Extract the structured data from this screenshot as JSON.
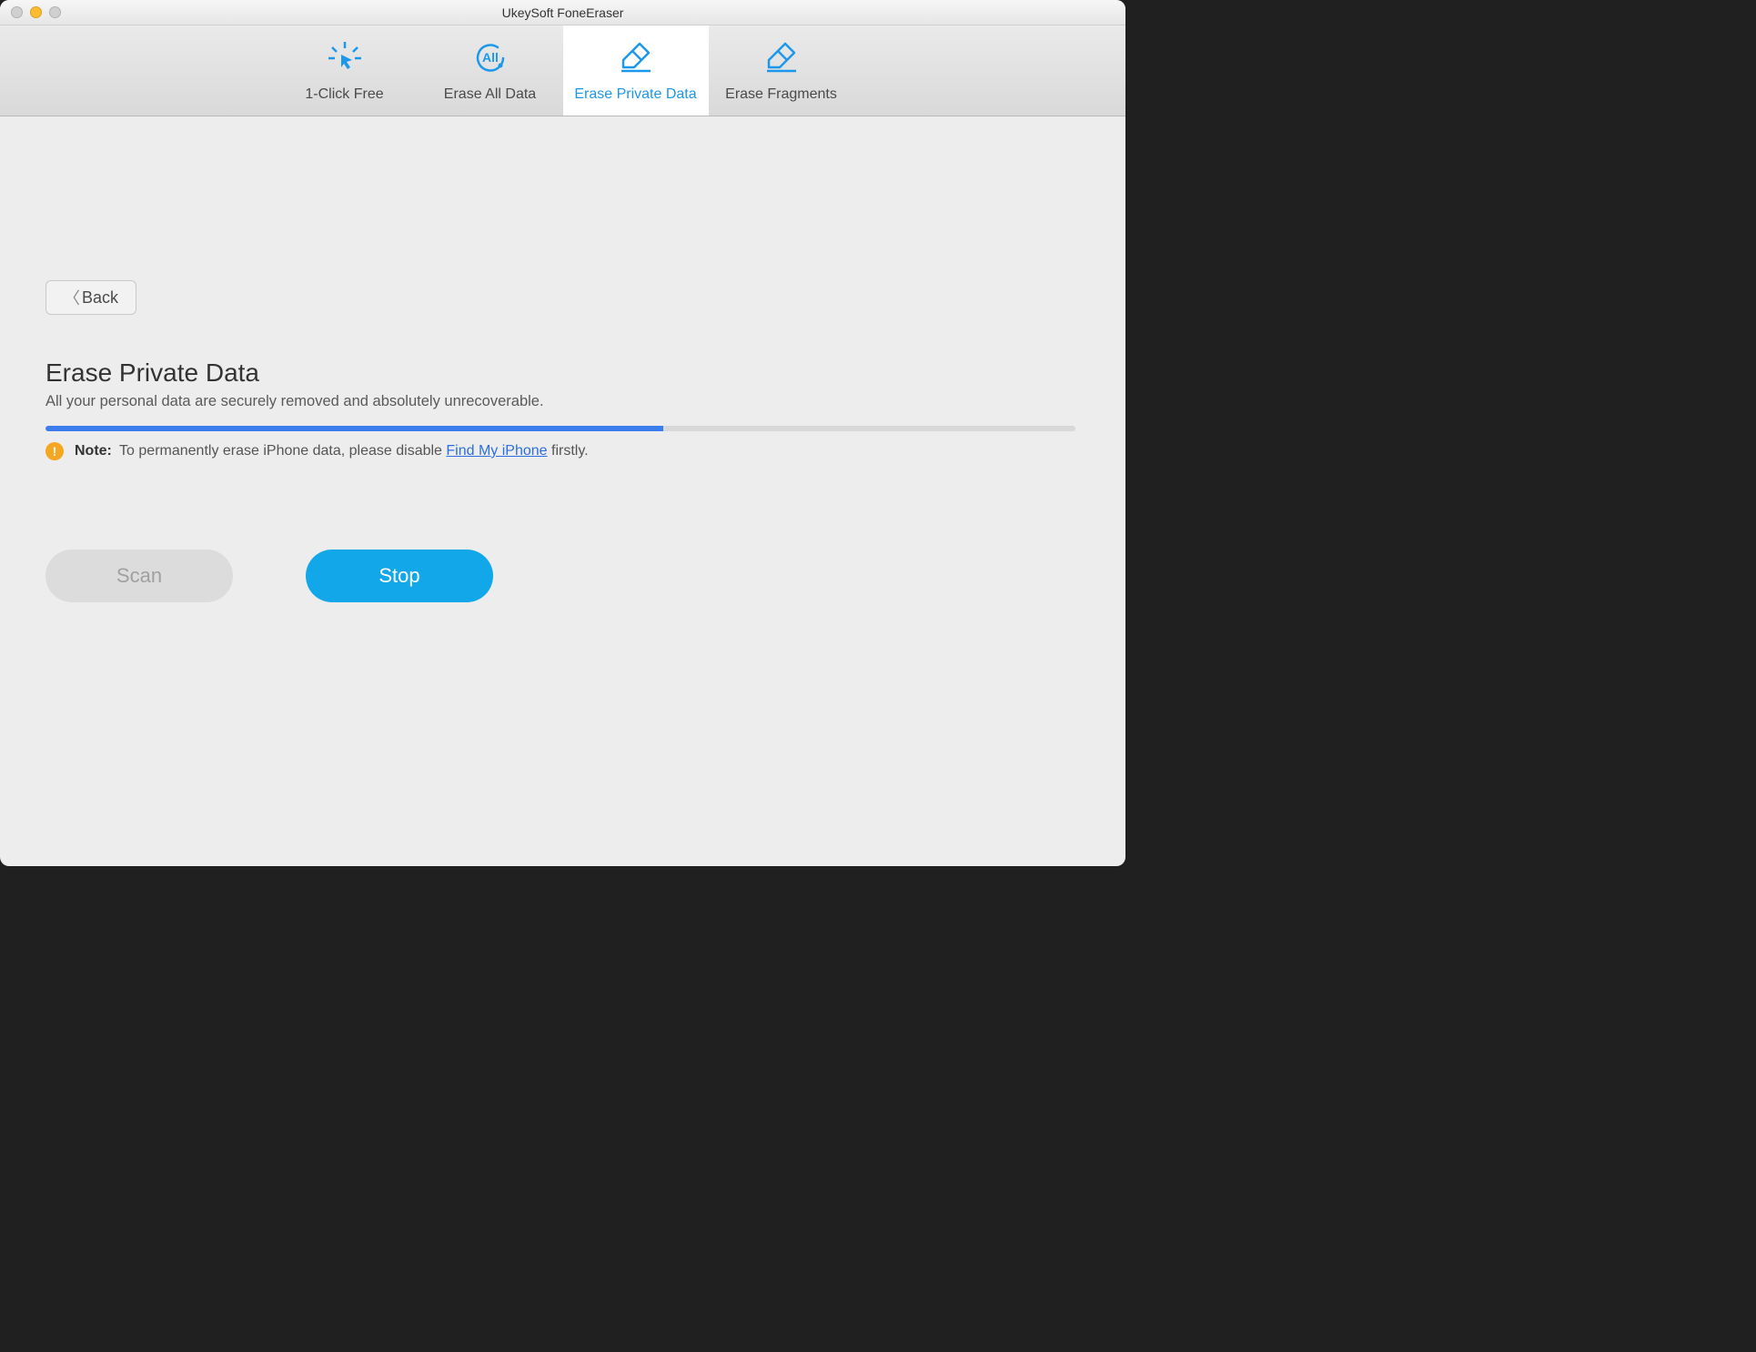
{
  "window": {
    "title": "UkeySoft FoneEraser"
  },
  "toolbar": {
    "items": [
      {
        "label": "1-Click Free",
        "active": false
      },
      {
        "label": "Erase All Data",
        "active": false
      },
      {
        "label": "Erase Private Data",
        "active": true
      },
      {
        "label": "Erase Fragments",
        "active": false
      }
    ]
  },
  "back_button": {
    "label": "Back"
  },
  "page": {
    "heading": "Erase Private Data",
    "subheading": "All your personal data are securely removed and absolutely unrecoverable."
  },
  "progress": {
    "percent": 60
  },
  "note": {
    "label": "Note:",
    "pre_text": "To permanently erase iPhone data, please disable ",
    "link_text": "Find My iPhone",
    "post_text": " firstly."
  },
  "buttons": {
    "scan": "Scan",
    "stop": "Stop"
  }
}
